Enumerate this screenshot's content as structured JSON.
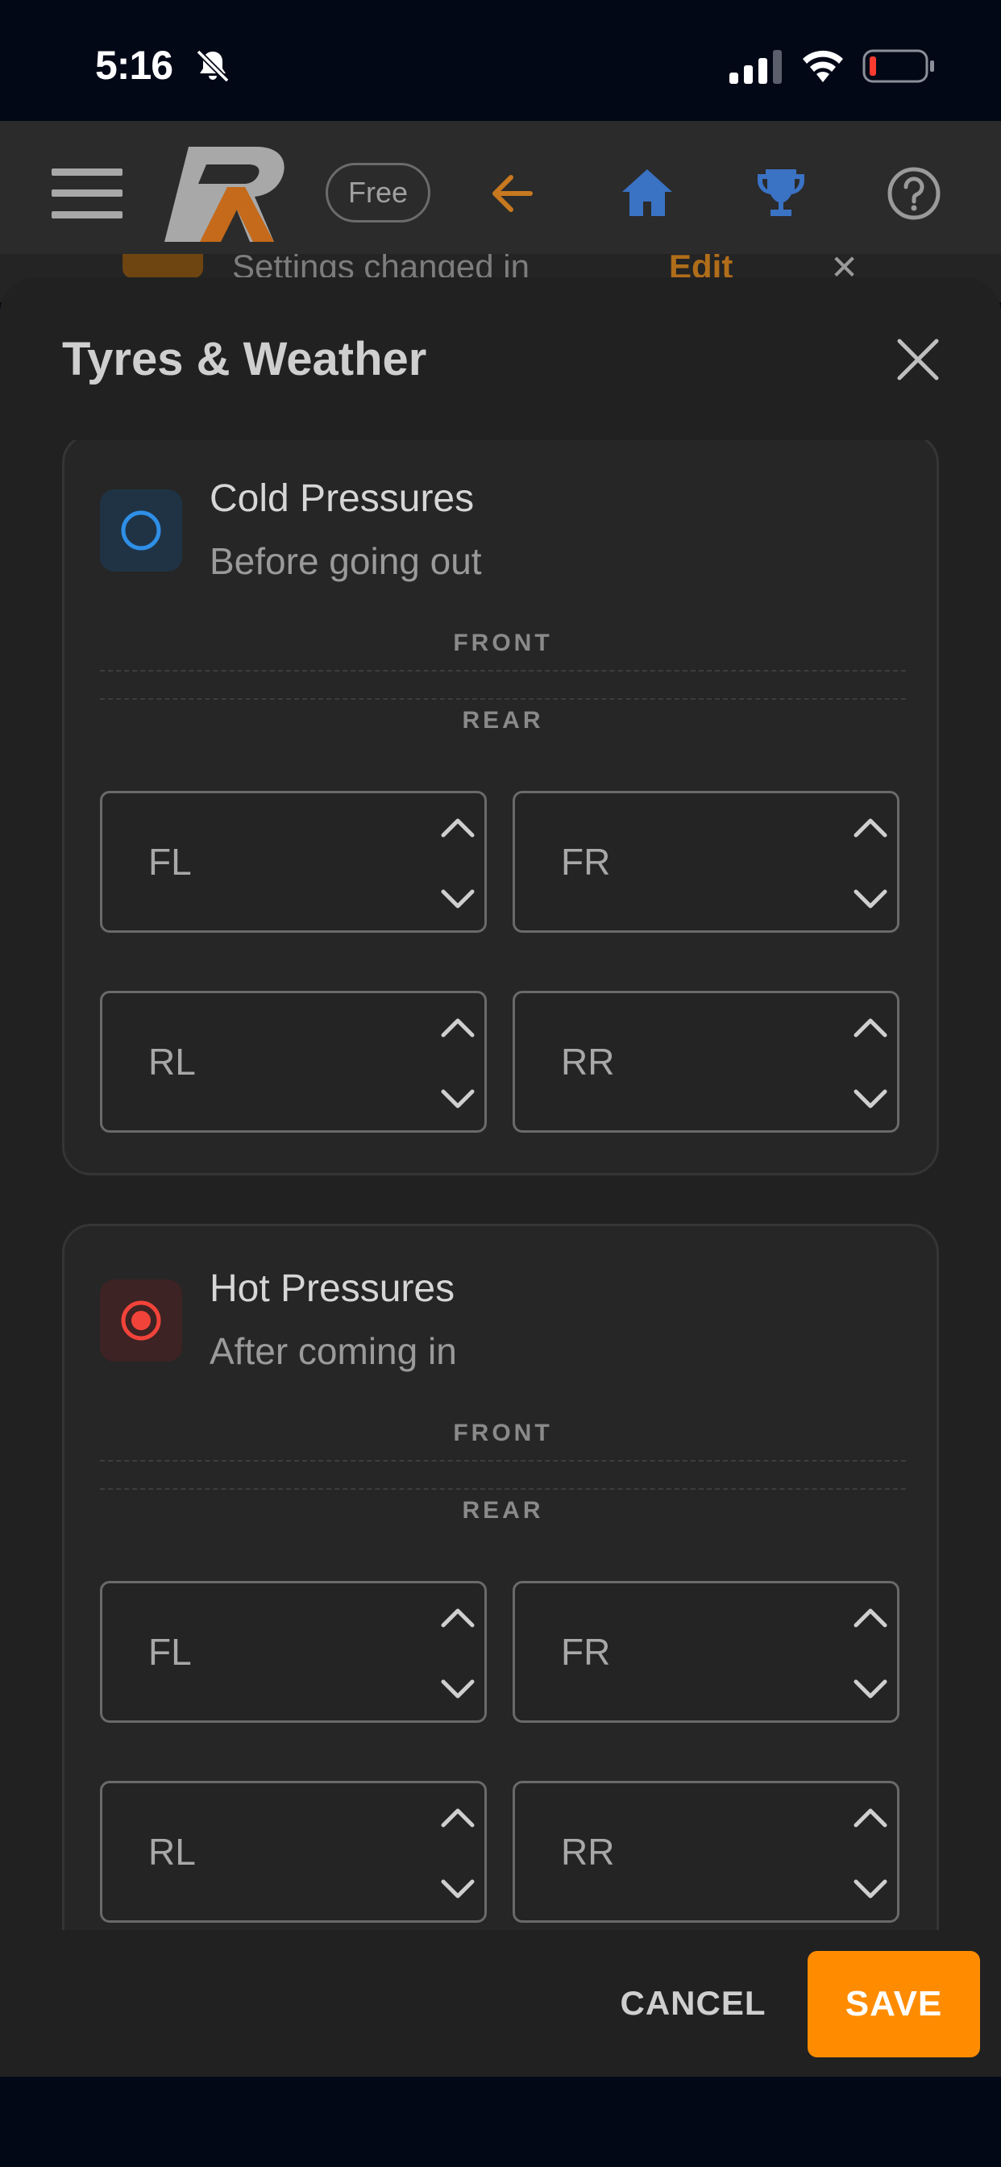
{
  "status_bar": {
    "time": "5:16",
    "icons": [
      "bell-slash-icon",
      "cellular-signal-icon",
      "wifi-icon",
      "battery-low-icon"
    ]
  },
  "app_bar": {
    "badge": "Free",
    "icons": [
      "menu-icon",
      "logo",
      "back-arrow-icon",
      "home-icon",
      "trophy-icon",
      "help-icon"
    ],
    "colors": {
      "back": "#c8781f",
      "home": "#3a72c4",
      "trophy": "#3a72c4",
      "help": "#9a9a9a"
    }
  },
  "background_notice": {
    "text": "Settings changed in",
    "action": "Edit"
  },
  "dialog": {
    "title": "Tyres & Weather",
    "cards": [
      {
        "id": "cold",
        "title": "Cold Pressures",
        "subtitle": "Before going out",
        "icon": "circle-outline-icon",
        "accent": "#2f8fe6",
        "front_label": "FRONT",
        "rear_label": "REAR",
        "fields": {
          "fl": {
            "placeholder": "FL",
            "value": ""
          },
          "fr": {
            "placeholder": "FR",
            "value": ""
          },
          "rl": {
            "placeholder": "RL",
            "value": ""
          },
          "rr": {
            "placeholder": "RR",
            "value": ""
          }
        }
      },
      {
        "id": "hot",
        "title": "Hot Pressures",
        "subtitle": "After coming in",
        "icon": "radio-filled-icon",
        "accent": "#f2433a",
        "front_label": "FRONT",
        "rear_label": "REAR",
        "fields": {
          "fl": {
            "placeholder": "FL",
            "value": ""
          },
          "fr": {
            "placeholder": "FR",
            "value": ""
          },
          "rl": {
            "placeholder": "RL",
            "value": ""
          },
          "rr": {
            "placeholder": "RR",
            "value": ""
          }
        }
      }
    ],
    "cancel_label": "CANCEL",
    "save_label": "SAVE",
    "save_color": "#ff8c00"
  }
}
